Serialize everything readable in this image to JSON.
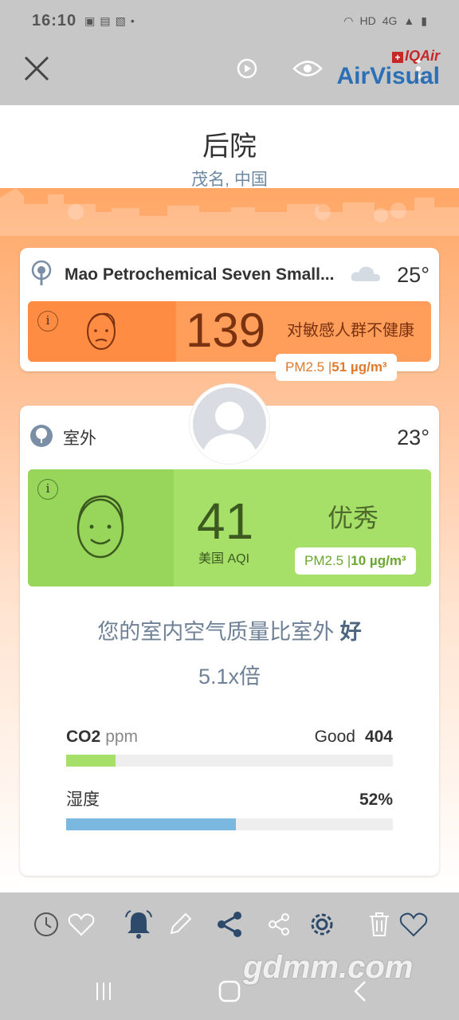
{
  "status_bar": {
    "time": "16:10",
    "left_icons": [
      "gallery-icon",
      "sim-icon",
      "screenshot-icon",
      "dot-icon"
    ],
    "right_icons": [
      "wifi-icon",
      "hd-icon",
      "4g-icon",
      "signal-icon",
      "battery-icon"
    ]
  },
  "header": {
    "brand_top": "IQAir",
    "brand_main": "AirVisual"
  },
  "location": {
    "title": "后院",
    "subtitle": "茂名, 中国"
  },
  "station_card": {
    "name": "Mao Petrochemical Seven Small...",
    "temperature": "25°",
    "aqi": "139",
    "aqi_description": "对敏感人群不健康",
    "pm_label": "PM2.5 | ",
    "pm_value": "51 µg/m³",
    "colors": {
      "dark": "#ff8c42",
      "light": "#ff9d5a",
      "text": "#7a3210"
    }
  },
  "indoor_card": {
    "outdoor_label": "室外",
    "temperature": "23°",
    "aqi": "41",
    "aqi_unit_label": "美国 AQI",
    "aqi_description": "优秀",
    "pm_label": "PM2.5 | ",
    "pm_value": "10 µg/m³",
    "compare_text": "您的室内空气质量比室外 ",
    "compare_emphasis": "好",
    "ratio": "5.1x倍",
    "colors": {
      "dark": "#97d65a",
      "light": "#a6e068"
    }
  },
  "metrics": [
    {
      "label": "CO2",
      "unit": "ppm",
      "status": "Good",
      "value": "404",
      "fill_fraction": 0.15,
      "color": "#a6e068"
    },
    {
      "label": "湿度",
      "unit": "",
      "status": "",
      "value": "52%",
      "fill_fraction": 0.52,
      "color": "#7ab8e0"
    }
  ],
  "toolbar_icons": [
    "history-icon",
    "heart-icon",
    "alert-bell-icon",
    "edit-icon",
    "share-icon",
    "share-outline-icon",
    "settings-icon",
    "trash-icon",
    "favorite-icon"
  ],
  "watermark": "gdmm.com"
}
